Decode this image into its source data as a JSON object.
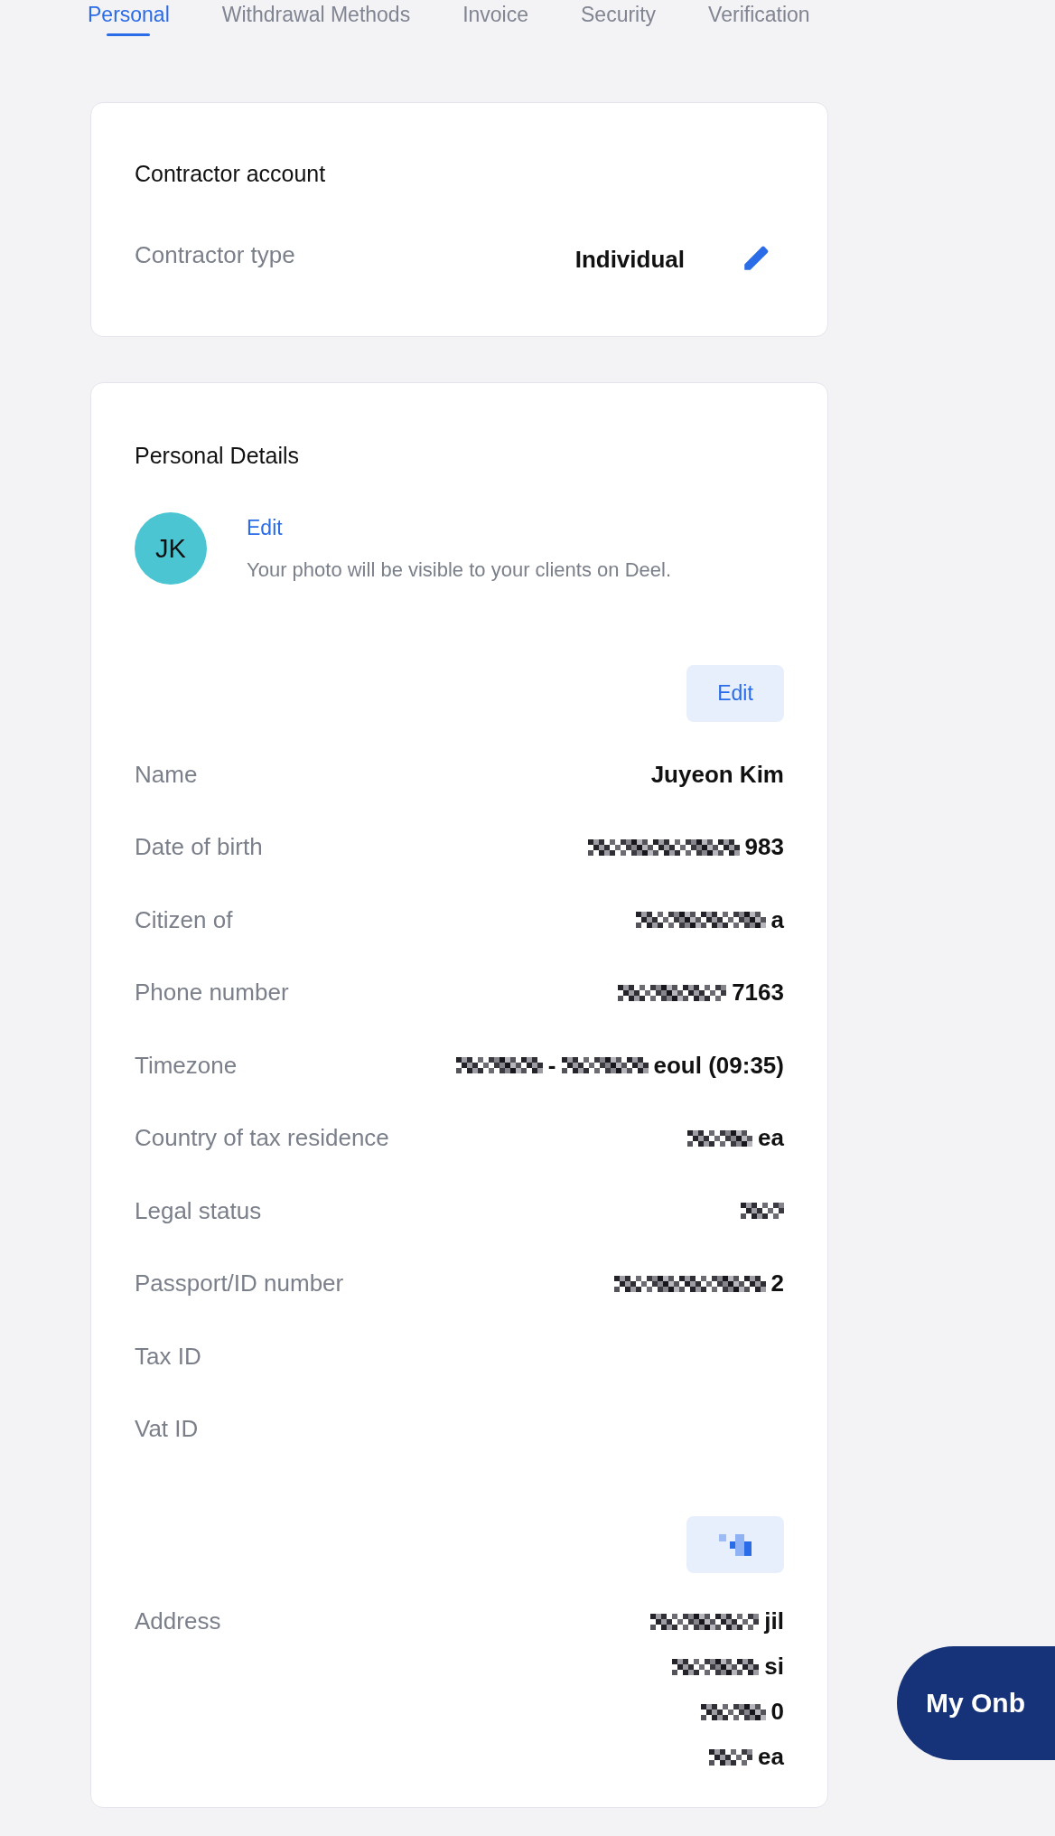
{
  "tabs": [
    {
      "label": "Personal",
      "selected": true
    },
    {
      "label": "Withdrawal Methods",
      "selected": false
    },
    {
      "label": "Invoice",
      "selected": false
    },
    {
      "label": "Security",
      "selected": false
    },
    {
      "label": "Verification",
      "selected": false
    }
  ],
  "contractor_account": {
    "title": "Contractor account",
    "label": "Contractor type",
    "value": "Individual"
  },
  "personal_details": {
    "title": "Personal Details",
    "avatar": {
      "initials": "JK",
      "color": "#4cc5d3"
    },
    "photo_edit": "Edit",
    "photo_note": "Your photo will be visible to your clients on Deel.",
    "edit_button": "Edit",
    "rows": [
      {
        "label": "Name",
        "value": [
          {
            "kind": "text",
            "text": "Juyeon Kim"
          }
        ]
      },
      {
        "label": "Date of birth",
        "value": [
          {
            "kind": "redacted"
          },
          {
            "kind": "text",
            "text": "983"
          }
        ]
      },
      {
        "label": "Citizen of",
        "value": [
          {
            "kind": "redacted"
          },
          {
            "kind": "text",
            "text": "a"
          }
        ]
      },
      {
        "label": "Phone number",
        "value": [
          {
            "kind": "redacted"
          },
          {
            "kind": "text",
            "text": "7163"
          }
        ]
      },
      {
        "label": "Timezone",
        "value": [
          {
            "kind": "redacted"
          },
          {
            "kind": "text",
            "text": "-"
          },
          {
            "kind": "redacted"
          },
          {
            "kind": "text",
            "text": "eoul (09:35)"
          }
        ]
      },
      {
        "label": "Country of tax residence",
        "value": [
          {
            "kind": "redacted"
          },
          {
            "kind": "text",
            "text": "ea"
          }
        ]
      },
      {
        "label": "Legal status",
        "value": [
          {
            "kind": "redacted"
          }
        ]
      },
      {
        "label": "Passport/ID number",
        "value": [
          {
            "kind": "redacted"
          },
          {
            "kind": "text",
            "text": "2"
          }
        ]
      },
      {
        "label": "Tax ID",
        "value": []
      },
      {
        "label": "Vat ID",
        "value": []
      }
    ],
    "address_label": "Address",
    "address_lines": [
      [
        {
          "kind": "redacted"
        },
        {
          "kind": "text",
          "text": "jil"
        }
      ],
      [
        {
          "kind": "redacted"
        },
        {
          "kind": "text",
          "text": "si"
        }
      ],
      [
        {
          "kind": "redacted"
        },
        {
          "kind": "text",
          "text": "0"
        }
      ],
      [
        {
          "kind": "redacted"
        },
        {
          "kind": "text",
          "text": "ea"
        }
      ]
    ]
  },
  "onboarding_button": "My Onb"
}
